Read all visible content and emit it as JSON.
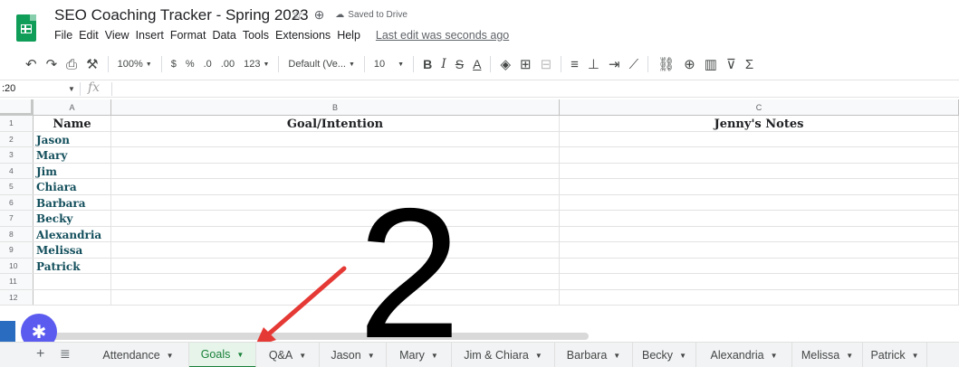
{
  "header": {
    "title": "SEO Coaching Tracker - Spring 2023",
    "saved_status": "Saved to Drive",
    "last_edit": "Last edit was seconds ago",
    "menu": [
      "File",
      "Edit",
      "View",
      "Insert",
      "Format",
      "Data",
      "Tools",
      "Extensions",
      "Help"
    ]
  },
  "toolbar": {
    "zoom": "100%",
    "currency": "$",
    "percent": "%",
    "decrease_decimal": ".0",
    "increase_decimal": ".00",
    "number_format": "123",
    "font": "Default (Ve...",
    "font_size": "10",
    "bold": "B",
    "italic": "I",
    "strike": "S",
    "text_color": "A",
    "sum": "Σ"
  },
  "formula_bar": {
    "namebox": ":20",
    "fx": "fx"
  },
  "columns": [
    {
      "letter": "A",
      "header": "Name"
    },
    {
      "letter": "B",
      "header": "Goal/Intention"
    },
    {
      "letter": "C",
      "header": "Jenny's Notes"
    }
  ],
  "rows": [
    {
      "num": "1"
    },
    {
      "num": "2",
      "name": "Jason"
    },
    {
      "num": "3",
      "name": "Mary"
    },
    {
      "num": "4",
      "name": "Jim"
    },
    {
      "num": "5",
      "name": "Chiara"
    },
    {
      "num": "6",
      "name": "Barbara"
    },
    {
      "num": "7",
      "name": "Becky"
    },
    {
      "num": "8",
      "name": "Alexandria"
    },
    {
      "num": "9",
      "name": "Melissa"
    },
    {
      "num": "10",
      "name": "Patrick"
    },
    {
      "num": "11",
      "name": ""
    },
    {
      "num": "12",
      "name": ""
    }
  ],
  "overlay_number": "2",
  "sheet_tabs": [
    {
      "label": "Attendance",
      "active": false
    },
    {
      "label": "Goals",
      "active": true
    },
    {
      "label": "Q&A",
      "active": false
    },
    {
      "label": "Jason",
      "active": false
    },
    {
      "label": "Mary",
      "active": false
    },
    {
      "label": "Jim & Chiara",
      "active": false
    },
    {
      "label": "Barbara",
      "active": false
    },
    {
      "label": "Becky",
      "active": false
    },
    {
      "label": "Alexandria",
      "active": false
    },
    {
      "label": "Melissa",
      "active": false
    },
    {
      "label": "Patrick",
      "active": false
    }
  ],
  "colors": {
    "name_text": "#134f5c",
    "active_tab": "#188038",
    "arrow": "#e53935",
    "logo": "#0f9d58"
  }
}
